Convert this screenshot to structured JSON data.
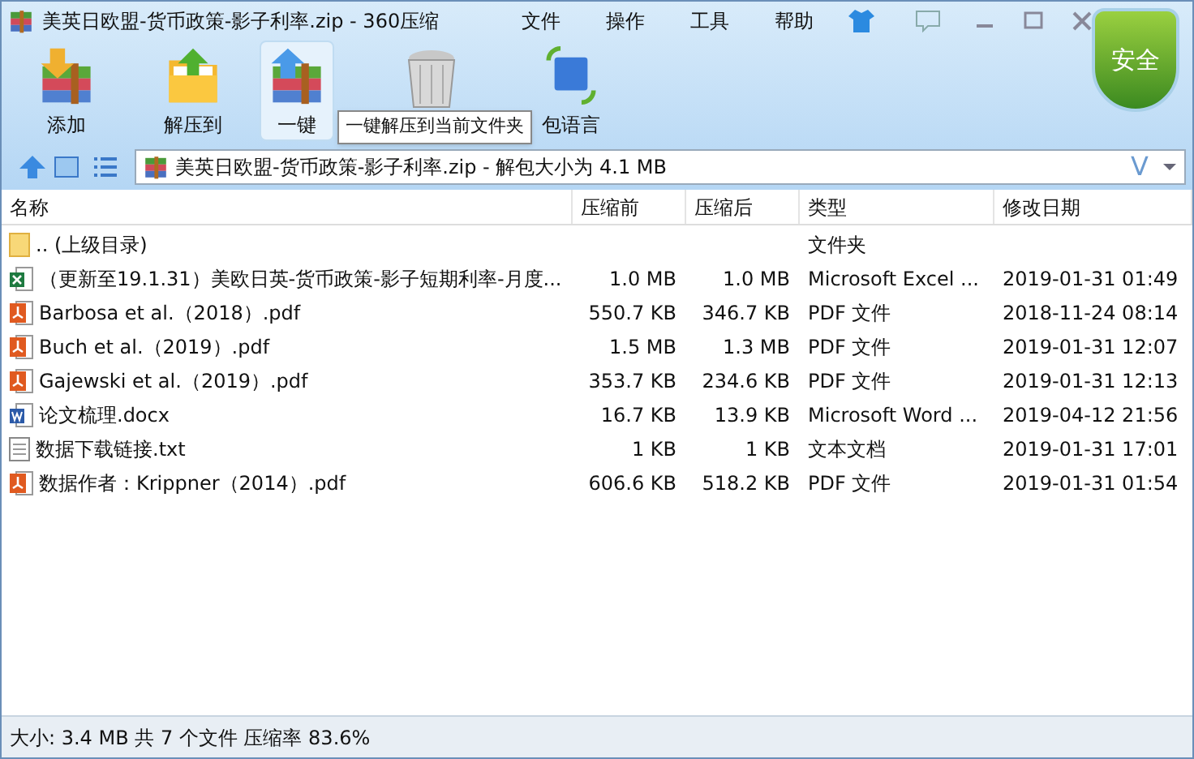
{
  "window": {
    "title": "美英日欧盟-货币政策-影子利率.zip - 360压缩"
  },
  "menu": [
    "文件",
    "操作",
    "工具",
    "帮助"
  ],
  "toolbar": [
    {
      "kind": "add",
      "label": "添加",
      "hovered": false
    },
    {
      "kind": "extract",
      "label": "解压到",
      "hovered": false
    },
    {
      "kind": "oneclick",
      "label": "一键",
      "hovered": true
    },
    {
      "kind": "delete",
      "hovered": false
    },
    {
      "kind": "encoding",
      "label": "包语言",
      "hovered": false
    }
  ],
  "tooltip": "一键解压到当前文件夹",
  "security_badge": "安全",
  "address": {
    "value": "美英日欧盟-货币政策-影子利率.zip - 解包大小为 4.1 MB",
    "v_mark": "V"
  },
  "table": {
    "columns": [
      "名称",
      "压缩前",
      "压缩后",
      "类型",
      "修改日期"
    ],
    "rows": [
      {
        "kind": "folder",
        "name": ".. (上级目录)",
        "size": "",
        "packed": "",
        "type": "文件夹",
        "modified": ""
      },
      {
        "kind": "excel",
        "name": "（更新至19.1.31）美欧日英-货币政策-影子短期利率-月度...",
        "size": "1.0 MB",
        "packed": "1.0 MB",
        "type": "Microsoft Excel ...",
        "modified": "2019-01-31 01:49"
      },
      {
        "kind": "pdf",
        "name": "Barbosa et al.（2018）.pdf",
        "size": "550.7 KB",
        "packed": "346.7 KB",
        "type": "PDF 文件",
        "modified": "2018-11-24 08:14"
      },
      {
        "kind": "pdf",
        "name": "Buch et al.（2019）.pdf",
        "size": "1.5 MB",
        "packed": "1.3 MB",
        "type": "PDF 文件",
        "modified": "2019-01-31 12:07"
      },
      {
        "kind": "pdf",
        "name": "Gajewski et al.（2019）.pdf",
        "size": "353.7 KB",
        "packed": "234.6 KB",
        "type": "PDF 文件",
        "modified": "2019-01-31 12:13"
      },
      {
        "kind": "word",
        "name": "论文梳理.docx",
        "size": "16.7 KB",
        "packed": "13.9 KB",
        "type": "Microsoft Word ...",
        "modified": "2019-04-12 21:56"
      },
      {
        "kind": "text",
        "name": "数据下载链接.txt",
        "size": "1 KB",
        "packed": "1 KB",
        "type": "文本文档",
        "modified": "2019-01-31 17:01"
      },
      {
        "kind": "pdf",
        "name": "数据作者：Krippner（2014）.pdf",
        "size": "606.6 KB",
        "packed": "518.2 KB",
        "type": "PDF 文件",
        "modified": "2019-01-31 01:54"
      }
    ]
  },
  "status_bar": "大小: 3.4 MB 共 7 个文件 压缩率 83.6%"
}
